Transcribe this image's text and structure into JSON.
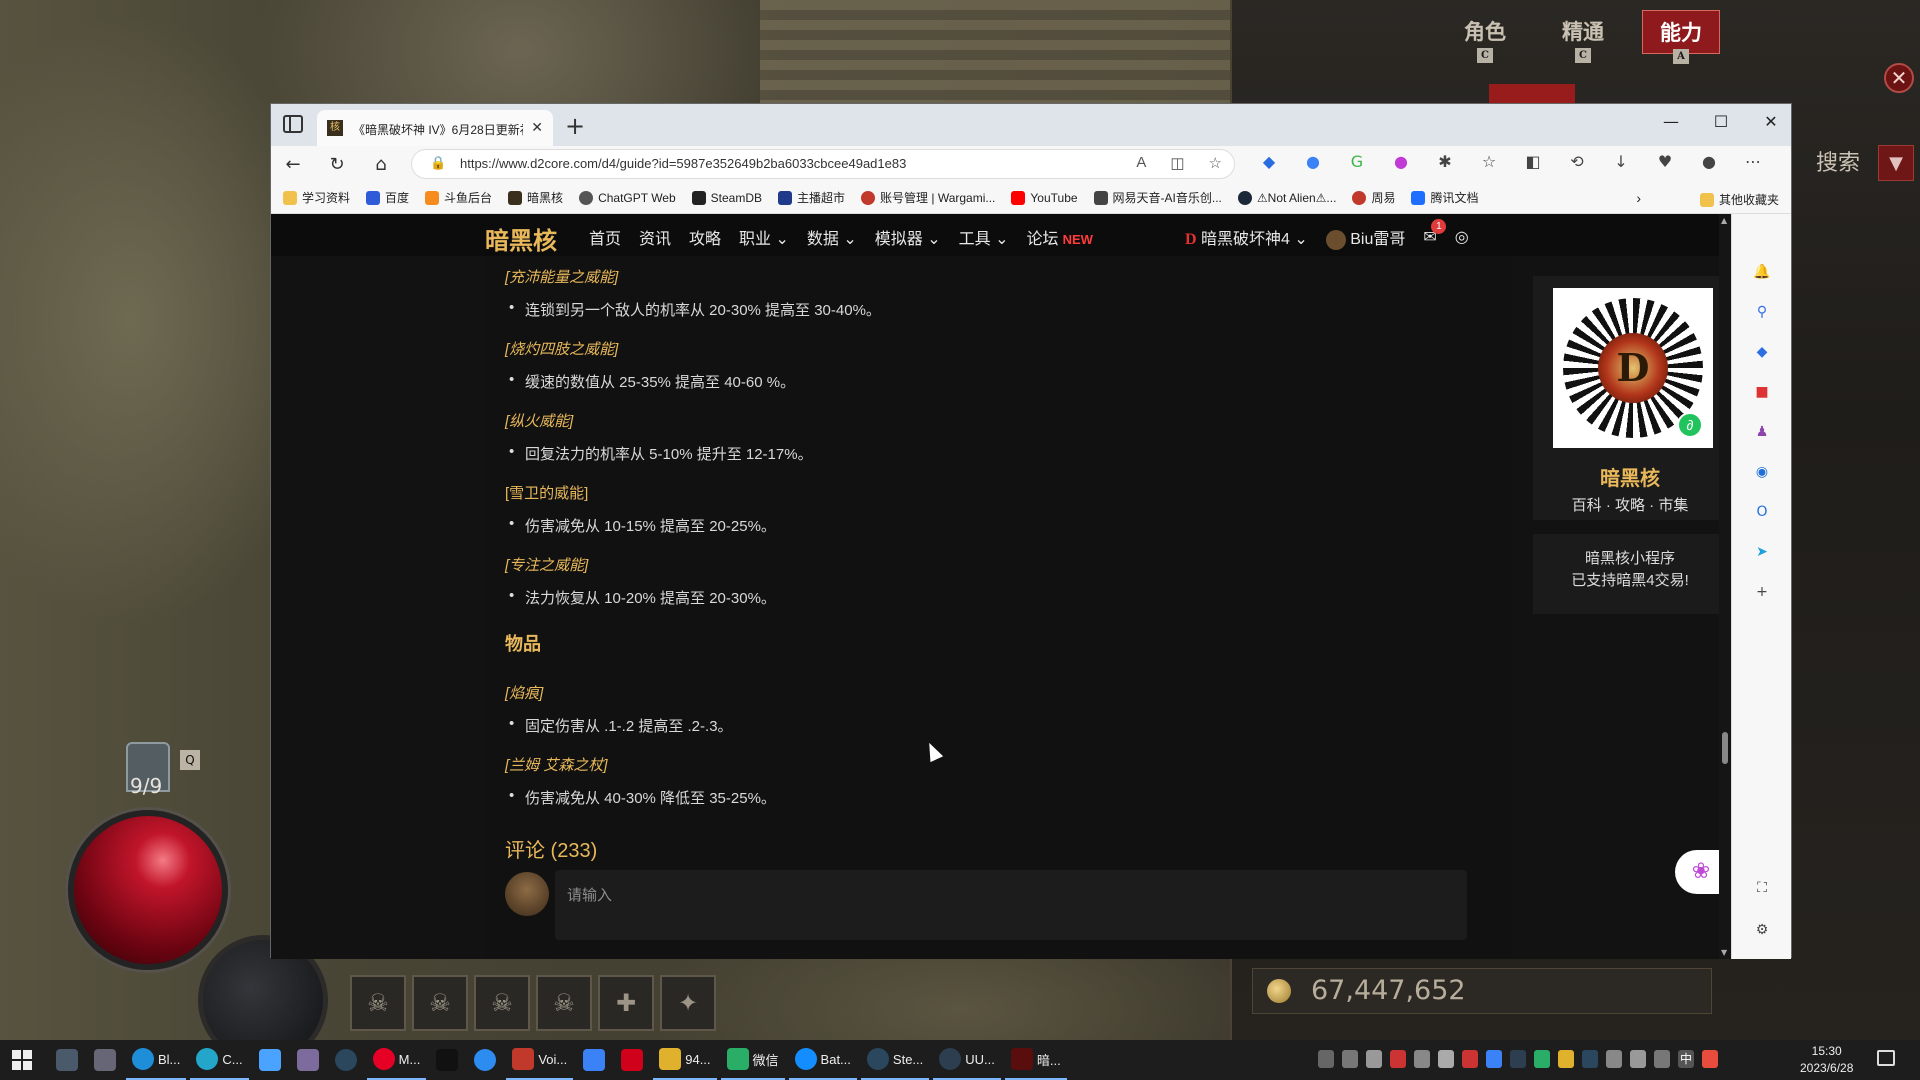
{
  "game": {
    "tabs": [
      {
        "label": "角色",
        "key": "C"
      },
      {
        "label": "精通",
        "key": "C"
      },
      {
        "label": "能力",
        "key": "A"
      }
    ],
    "search_label": "搜索",
    "potions": "9/9",
    "gold": "67,447,652"
  },
  "browser": {
    "tab_title": "《暗黑破坏神 IV》6月28日更新补...",
    "url": "https://www.d2core.com/d4/guide?id=5987e352649b2ba6033cbcee49ad1e83",
    "bookmarks": [
      "学习资料",
      "百度",
      "斗鱼后台",
      "暗黑核",
      "ChatGPT Web",
      "SteamDB",
      "主播超市",
      "账号管理 | Wargami...",
      "YouTube",
      "网易天音-AI音乐创...",
      "⚠Not Alien⚠...",
      "周易",
      "腾讯文档"
    ],
    "bookmark_other": "其他收藏夹"
  },
  "site": {
    "logo": "暗黑核",
    "nav": [
      "首页",
      "资讯",
      "攻略",
      "职业",
      "数据",
      "模拟器",
      "工具",
      "论坛"
    ],
    "nav_new": "NEW",
    "game_select": "暗黑破坏神4",
    "username": "Biu雷哥",
    "mail_count": "1"
  },
  "article": {
    "sections": [
      {
        "title": "[充沛能量之威能]",
        "bullet": "连锁到另一个敌人的机率从 20-30% 提高至 30-40%。"
      },
      {
        "title": "[烧灼四肢之威能]",
        "bullet": "缓速的数值从 25-35% 提高至 40-60 %。"
      },
      {
        "title": "[纵火威能]",
        "bullet": "回复法力的机率从 5-10% 提升至 12-17%。"
      },
      {
        "title": "[雪卫的威能]",
        "bullet": "伤害减免从 10-15% 提高至 20-25%。"
      },
      {
        "title": "[专注之威能]",
        "bullet": "法力恢复从 10-20% 提高至 20-30%。"
      }
    ],
    "items_heading": "物品",
    "items": [
      {
        "title": "[焰痕]",
        "bullet": "固定伤害从 .1-.2 提高至 .2-.3。"
      },
      {
        "title": "[兰姆 艾森之杖]",
        "bullet": "伤害减免从 40-30% 降低至 35-25%。"
      }
    ],
    "comments_title": "评论 (233)",
    "comment_placeholder": "请输入"
  },
  "sidebar": {
    "qr_title": "暗黑核",
    "qr_sub": "百科 · 攻略 · 市集",
    "mini_line1": "暗黑核小程序",
    "mini_line2": "已支持暗黑4交易!"
  },
  "taskbar": {
    "apps": [
      "Bl...",
      "",
      "",
      "",
      "",
      "",
      "M...",
      "",
      "",
      "Voi...",
      "",
      "",
      "94...",
      "微信",
      "Bat...",
      "Ste...",
      "UU...",
      "暗..."
    ],
    "time": "15:30",
    "date": "2023/6/28"
  }
}
